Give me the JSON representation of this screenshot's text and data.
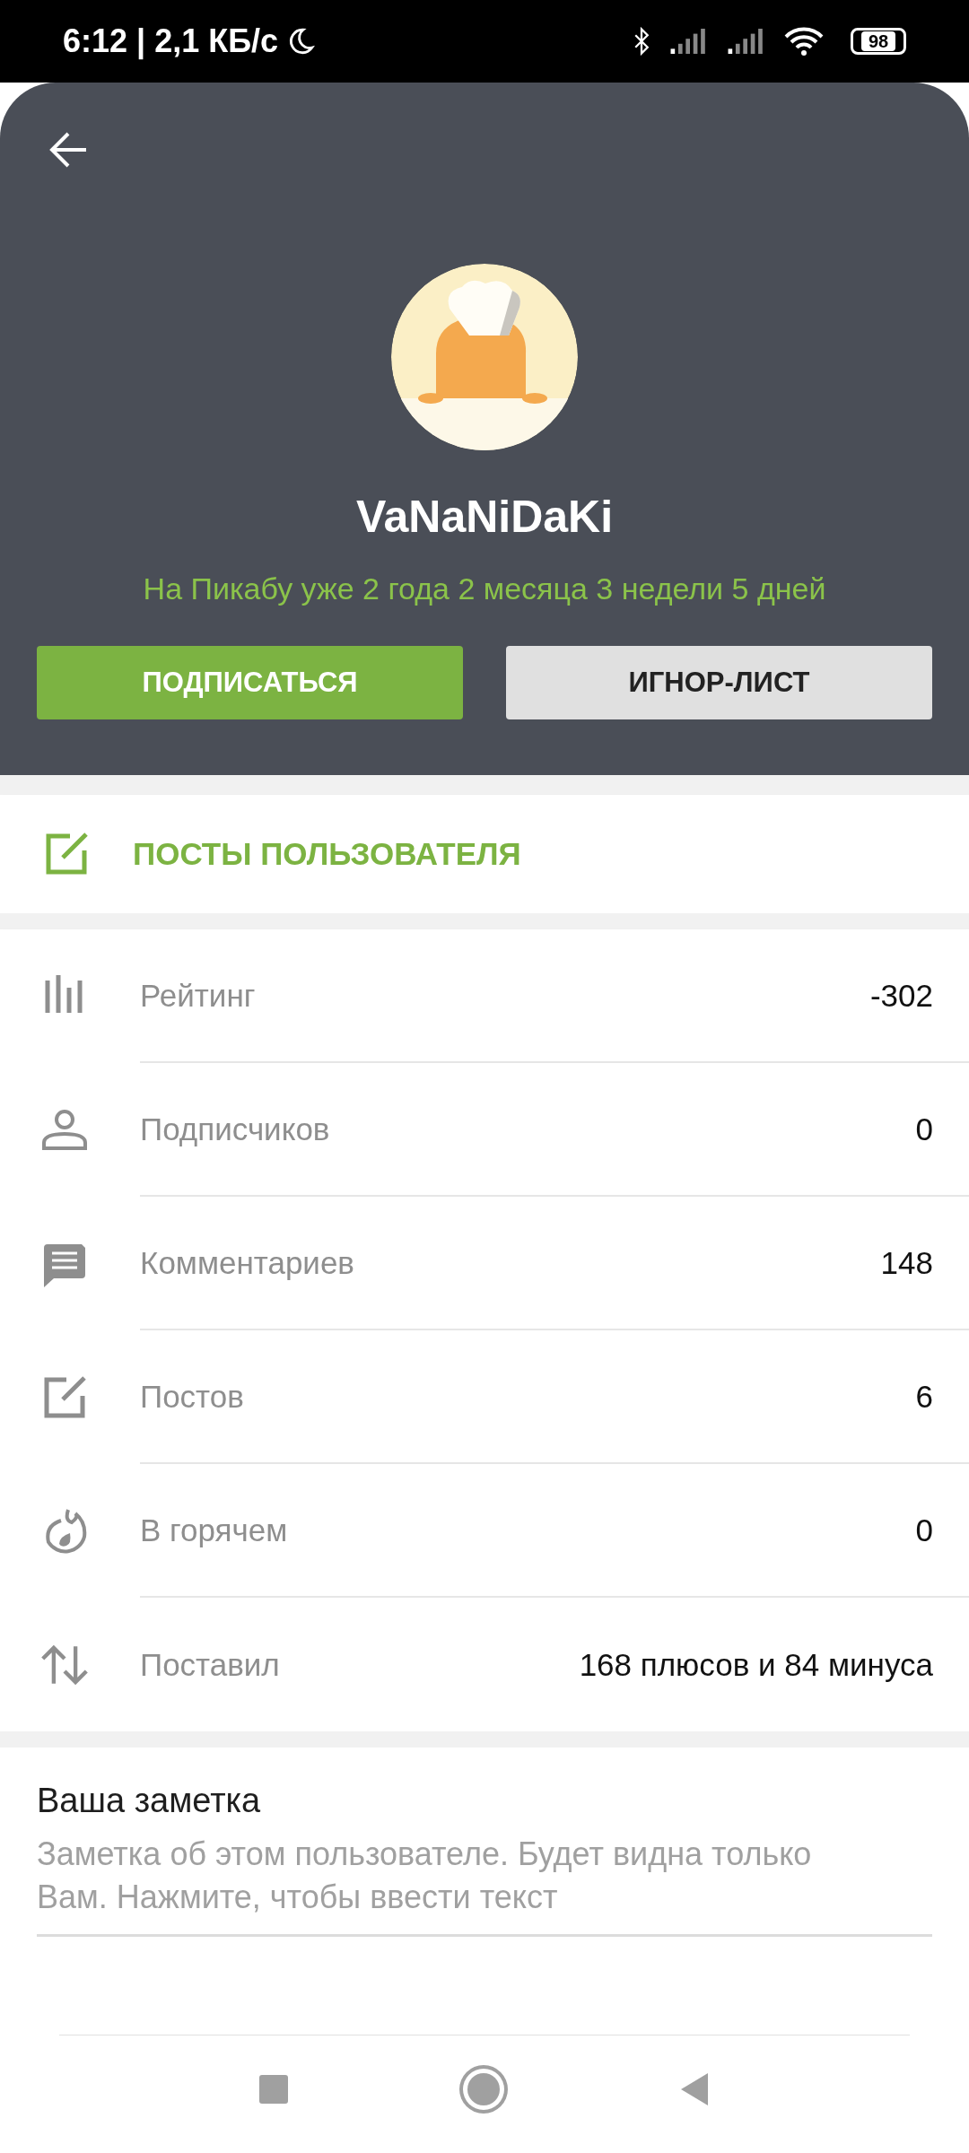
{
  "status_bar": {
    "time": "6:12 | 2,1 КБ/с",
    "battery": "98"
  },
  "profile": {
    "username": "VaNaNiDaKi",
    "tenure": "На Пикабу уже 2 года 2 месяца 3 недели 5 дней",
    "buttons": [
      {
        "label": "ПОДПИСАТЬСЯ",
        "kind": "primary"
      },
      {
        "label": "ИГНОР-ЛИСТ",
        "kind": "secondary"
      }
    ]
  },
  "posts_link": {
    "label": "ПОСТЫ ПОЛЬЗОВАТЕЛЯ"
  },
  "stats": [
    {
      "kind": "rating",
      "label": "Рейтинг",
      "value": "-302"
    },
    {
      "kind": "subscribers",
      "label": "Подписчиков",
      "value": "0"
    },
    {
      "kind": "comments",
      "label": "Комментариев",
      "value": "148"
    },
    {
      "kind": "posts",
      "label": "Постов",
      "value": "6"
    },
    {
      "kind": "hot",
      "label": "В горячем",
      "value": "0"
    },
    {
      "kind": "votes",
      "label": "Поставил",
      "value": "168 плюсов и 84 минуса"
    }
  ],
  "note": {
    "title": "Ваша заметка",
    "placeholder": "Заметка об этом пользователе. Будет видна только Вам. Нажмите, чтобы ввести текст"
  }
}
